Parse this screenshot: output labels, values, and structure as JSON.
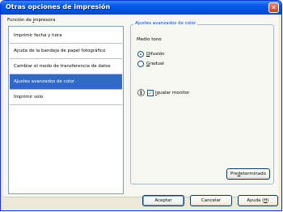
{
  "window": {
    "title": "Otras opciones de impresión",
    "close_symbol": "✕"
  },
  "function_label": {
    "prefix": "Función de ",
    "underlined": "i",
    "suffix": "mpresora"
  },
  "list": {
    "items": [
      {
        "label": "Imprimir fecha y hora",
        "selected": false
      },
      {
        "label": "Ayuda de la bandeja de papel fotográfico",
        "selected": false
      },
      {
        "label": "Cambiar el modo de transferencia de datos",
        "selected": false
      },
      {
        "label": "Ajustes avanzados de color",
        "selected": true
      },
      {
        "label": "Imprimir solo",
        "selected": false
      }
    ]
  },
  "panel": {
    "title": "Ajustes avanzados de color",
    "halftone_label": "Medio tono",
    "radio_diffusion": {
      "underlined": "D",
      "rest": "ifusión",
      "checked": true
    },
    "radio_dither": {
      "underlined": "G",
      "rest": "radual",
      "checked": false
    },
    "match_monitor": {
      "underlined": "I",
      "rest": "gualar monitor",
      "checked": true,
      "check_symbol": "✓"
    },
    "info_symbol": "i",
    "default_button": {
      "before": "Pre",
      "underlined": "d",
      "after": "eterminado"
    }
  },
  "buttons": {
    "accept": "Aceptar",
    "cancel": "Cancelar",
    "help": {
      "before": "Ayuda (",
      "underlined": "H",
      "after": ")"
    }
  },
  "colors": {
    "title_bar": "#0054e3",
    "selection": "#316ac5",
    "group_title": "#0046d5",
    "check_mark": "#21a121"
  }
}
